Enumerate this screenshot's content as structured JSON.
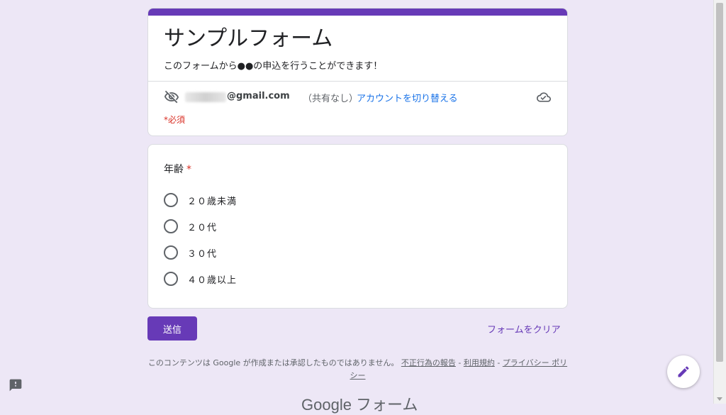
{
  "form": {
    "title": "サンプルフォーム",
    "description": "このフォームから●●の申込を行うことができます！",
    "email_domain": "@gmail.com",
    "shared_status": "（共有なし）",
    "switch_account": "アカウントを切り替える",
    "required_note": "*必須",
    "accent_color": "#673ab7"
  },
  "question": {
    "title": "年齢",
    "required_mark": "*",
    "options": [
      "２０歳未満",
      "２０代",
      "３０代",
      "４０歳以上"
    ]
  },
  "actions": {
    "submit": "送信",
    "clear": "フォームをクリア"
  },
  "footer": {
    "disclaimer": "このコンテンツは Google が作成または承認したものではありません。",
    "report_abuse": "不正行為の報告",
    "terms": "利用規約",
    "privacy": "プライバシー ポリシー",
    "sep1": " - ",
    "sep2": " - ",
    "brand": "Google フォーム"
  },
  "icons": {
    "eye_off": "eye-off-icon",
    "cloud": "cloud-done-icon",
    "edit": "pencil-icon",
    "report": "feedback-icon"
  }
}
